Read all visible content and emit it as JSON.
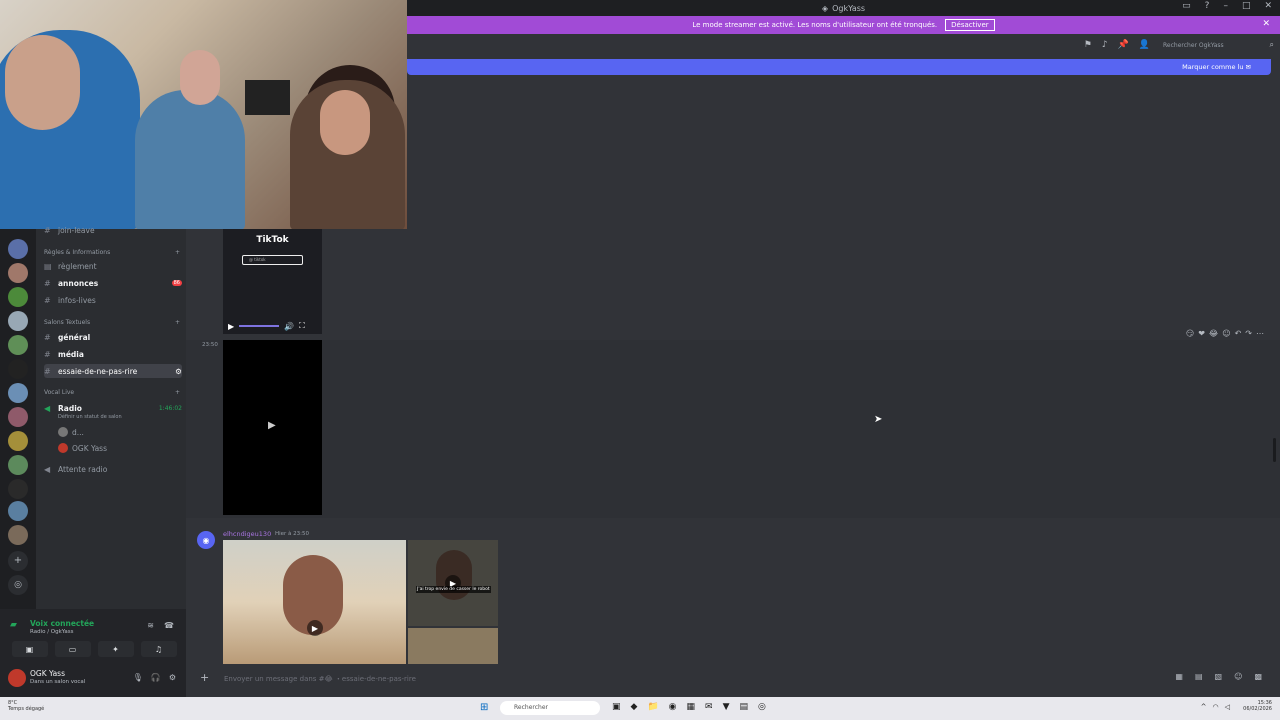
{
  "window": {
    "title": "OgkYass"
  },
  "banner": {
    "text": "Le mode streamer est activé. Les noms d'utilisateur ont été tronqués.",
    "button": "Désactiver"
  },
  "header": {
    "search_placeholder": "Rechercher OgkYass",
    "mark_read": "Marquer comme lu"
  },
  "sidebar": {
    "top_cut": "join-leave",
    "cat_rules": "Règles & Informations",
    "rule": "règlement",
    "announce": "annonces",
    "announce_badge": "86",
    "lives": "infos-lives",
    "cat_text": "Salons Textuels",
    "general": "général",
    "media": "média",
    "essaie": "essaie-de-ne-pas-rire",
    "cat_voice": "Vocal Live",
    "radio": "Radio",
    "radio_time": "1:46:02",
    "radio_sub": "Définir un statut de salon",
    "voice_user1": "d...",
    "voice_user2": "OGK Yass",
    "attente": "Attente radio"
  },
  "voice": {
    "status": "Voix connectée",
    "sub": "Radio / OgkYass"
  },
  "user": {
    "name": "OGK Yass",
    "status": "Dans un salon vocal"
  },
  "chat": {
    "tiktok_title": "TikTok",
    "tiktok_bar": "@ tiktok",
    "msg_time": "23:50",
    "msg2_author": "elhcndigeu130",
    "msg2_time": "Hier à 23:50",
    "media_caption": "J'ai trop envie de casser le robot"
  },
  "composer": {
    "placeholder": "Envoyer un message dans #😂 ・essaie-de-ne-pas-rire"
  },
  "taskbar": {
    "weather_temp": "8°C",
    "weather_desc": "Temps dégagé",
    "search": "Rechercher",
    "time": "15:36",
    "date": "06/02/2026"
  },
  "colors": {
    "banner": "#a14bd6",
    "blurple": "#5865f2",
    "online": "#23a55a",
    "danger": "#f23f43"
  }
}
